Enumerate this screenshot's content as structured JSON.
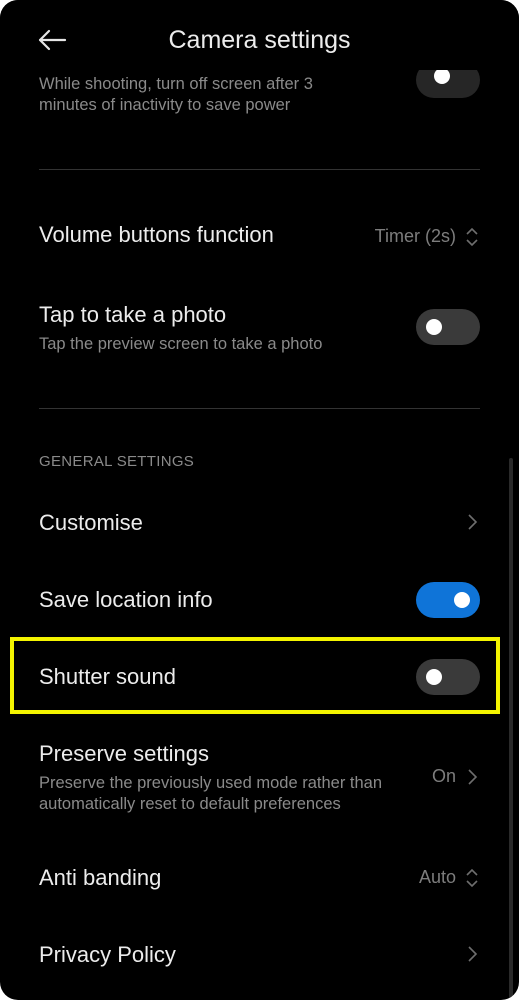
{
  "header": {
    "title": "Camera settings",
    "back_icon": "arrow-left-icon"
  },
  "items": {
    "screen_off": {
      "subtitle": "While shooting, turn off screen after 3 minutes of inactivity to save power",
      "toggle_state": "on"
    },
    "volume_buttons": {
      "label": "Volume buttons function",
      "value": "Timer (2s)",
      "icon": "chevron-updown-icon"
    },
    "tap_photo": {
      "label": "Tap to take a photo",
      "subtitle": "Tap the preview screen to take a photo",
      "toggle_state": "off"
    },
    "general_section": "GENERAL SETTINGS",
    "customise": {
      "label": "Customise",
      "icon": "chevron-right-icon"
    },
    "save_location": {
      "label": "Save location info",
      "toggle_state": "on"
    },
    "shutter_sound": {
      "label": "Shutter sound",
      "toggle_state": "off",
      "highlighted": true
    },
    "preserve_settings": {
      "label": "Preserve settings",
      "subtitle": "Preserve the previously used mode rather than automatically reset to default preferences",
      "value": "On",
      "icon": "chevron-right-icon"
    },
    "anti_banding": {
      "label": "Anti banding",
      "value": "Auto",
      "icon": "chevron-updown-icon"
    },
    "privacy_policy": {
      "label": "Privacy Policy",
      "icon": "chevron-right-icon"
    }
  },
  "colors": {
    "background": "#000000",
    "accent": "#0f74d8",
    "highlight": "#f4f400"
  }
}
